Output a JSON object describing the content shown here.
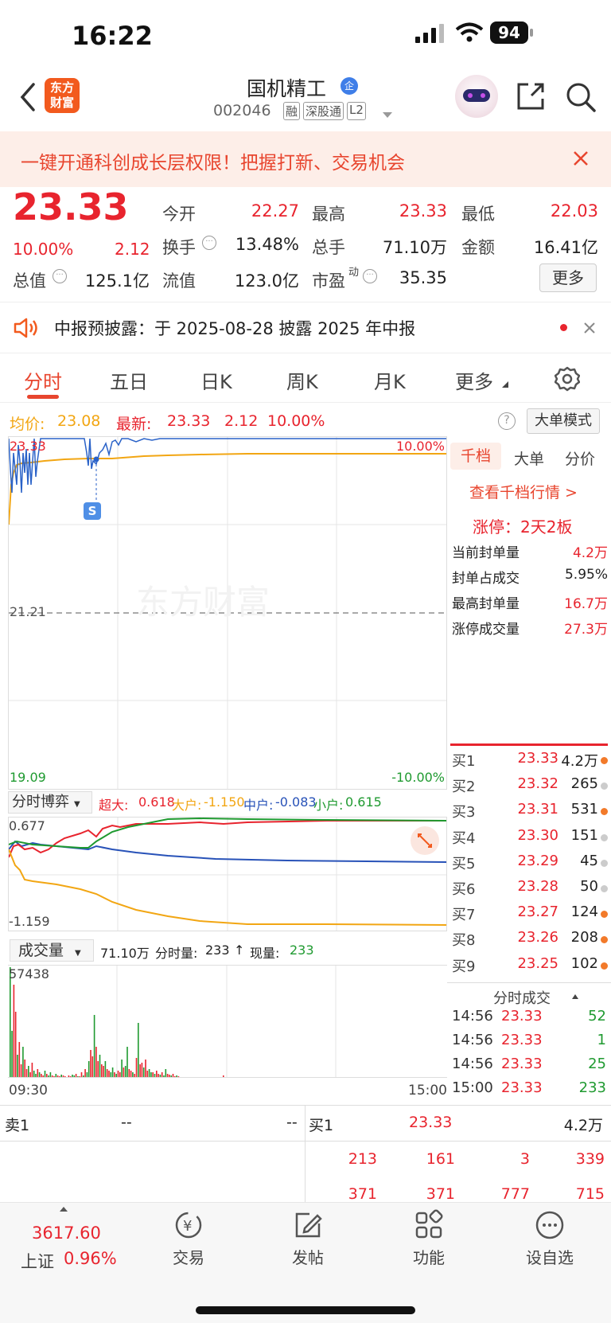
{
  "status_bar": {
    "time": "16:22",
    "battery": "94"
  },
  "header": {
    "logo_text_1": "东方",
    "logo_text_2": "财富",
    "stock_name": "国机精工",
    "badge": "企",
    "code": "002046",
    "tags": [
      "融",
      "深股通",
      "L2"
    ]
  },
  "banner": {
    "text": "一键开通科创成长层权限！把握打新、交易机会"
  },
  "quote": {
    "price": "23.33",
    "change_pct": "10.00%",
    "change": "2.12",
    "open_label": "今开",
    "open": "22.27",
    "high_label": "最高",
    "high": "23.33",
    "low_label": "最低",
    "low": "22.03",
    "turnover_label": "换手",
    "turnover": "13.48%",
    "volume_label": "总手",
    "volume": "71.10万",
    "amount_label": "金额",
    "amount": "16.41亿",
    "mktcap_label": "总值",
    "mktcap": "125.1亿",
    "float_label": "流值",
    "float": "123.0亿",
    "pe_label": "市盈",
    "pe_sup": "动",
    "pe": "35.35",
    "more_label": "更多"
  },
  "notice": {
    "text": "中报预披露：于 2025-08-28 披露 2025 年中报"
  },
  "tabs": [
    {
      "label": "分时"
    },
    {
      "label": "五日"
    },
    {
      "label": "日K"
    },
    {
      "label": "周K"
    },
    {
      "label": "月K"
    },
    {
      "label": "更多"
    }
  ],
  "avgline": {
    "avg_label": "均价:",
    "avg": "23.08",
    "latest_label": "最新:",
    "latest": "23.33",
    "change": "2.12",
    "pct": "10.00%",
    "mode_button": "大单模式"
  },
  "chart": {
    "top_price": "23.33",
    "top_pct": "10.00%",
    "mid_price": "21.21",
    "bottom_price": "19.09",
    "bottom_pct": "-10.00%",
    "watermark": "东方财富",
    "marker": "S"
  },
  "right_panel": {
    "tabs": [
      "千档",
      "大单",
      "分价"
    ],
    "link": "查看千档行情 >",
    "limit_up": "涨停：2天2板",
    "rows": [
      {
        "label": "当前封单量",
        "value": "4.2万"
      },
      {
        "label": "封单占成交",
        "value": "5.95%"
      },
      {
        "label": "最高封单量",
        "value": "16.7万"
      },
      {
        "label": "涨停成交量",
        "value": "27.3万"
      }
    ]
  },
  "buy_book": [
    {
      "label": "买1",
      "price": "23.33",
      "qty": "4.2万",
      "dot": "#f27a2a"
    },
    {
      "label": "买2",
      "price": "23.32",
      "qty": "265",
      "dot": "#cccccc"
    },
    {
      "label": "买3",
      "price": "23.31",
      "qty": "531",
      "dot": "#f27a2a"
    },
    {
      "label": "买4",
      "price": "23.30",
      "qty": "151",
      "dot": "#cccccc"
    },
    {
      "label": "买5",
      "price": "23.29",
      "qty": "45",
      "dot": "#cccccc"
    },
    {
      "label": "买6",
      "price": "23.28",
      "qty": "50",
      "dot": "#cccccc"
    },
    {
      "label": "买7",
      "price": "23.27",
      "qty": "124",
      "dot": "#f27a2a"
    },
    {
      "label": "买8",
      "price": "23.26",
      "qty": "208",
      "dot": "#f27a2a"
    },
    {
      "label": "买9",
      "price": "23.25",
      "qty": "102",
      "dot": "#f27a2a"
    }
  ],
  "trades_header": "分时成交",
  "trades": [
    {
      "time": "14:56",
      "price": "23.33",
      "qty": "52"
    },
    {
      "time": "14:56",
      "price": "23.33",
      "qty": "1"
    },
    {
      "time": "14:56",
      "price": "23.33",
      "qty": "25"
    },
    {
      "time": "15:00",
      "price": "23.33",
      "qty": "233"
    }
  ],
  "game": {
    "selector": "分时博弈",
    "super_label": "超大:",
    "super": "0.618",
    "big_label": "大户:",
    "big": "-1.150",
    "mid_label": "中户:",
    "mid": "-0.083",
    "small_label": "小户:",
    "small": "0.615",
    "top": "0.677",
    "bottom": "-1.159"
  },
  "volume": {
    "selector": "成交量",
    "total": "71.10万",
    "tick_label": "分时量:",
    "tick": "233",
    "arrow": "↑",
    "cur_label": "现量:",
    "cur": "233",
    "max": "57438",
    "start_time": "09:30",
    "end_time": "15:00"
  },
  "bottom_table": {
    "sell1_label": "卖1",
    "sell1_price": "--",
    "sell1_qty": "--",
    "buy1_label": "买1",
    "buy1_price": "23.33",
    "buy1_qty": "4.2万",
    "row2": [
      "213",
      "161",
      "3",
      "339"
    ],
    "row3": [
      "371",
      "371",
      "777",
      "715"
    ]
  },
  "tabbar": {
    "index_value": "3617.60",
    "index_name": "上证",
    "index_pct": "0.96%",
    "items": [
      "交易",
      "发帖",
      "功能",
      "设自选"
    ]
  },
  "colors": {
    "up": "#e8242e",
    "down": "#1f9a30",
    "accent": "#e8452e",
    "avg": "#f2a613",
    "price_line": "#2a62c8"
  }
}
